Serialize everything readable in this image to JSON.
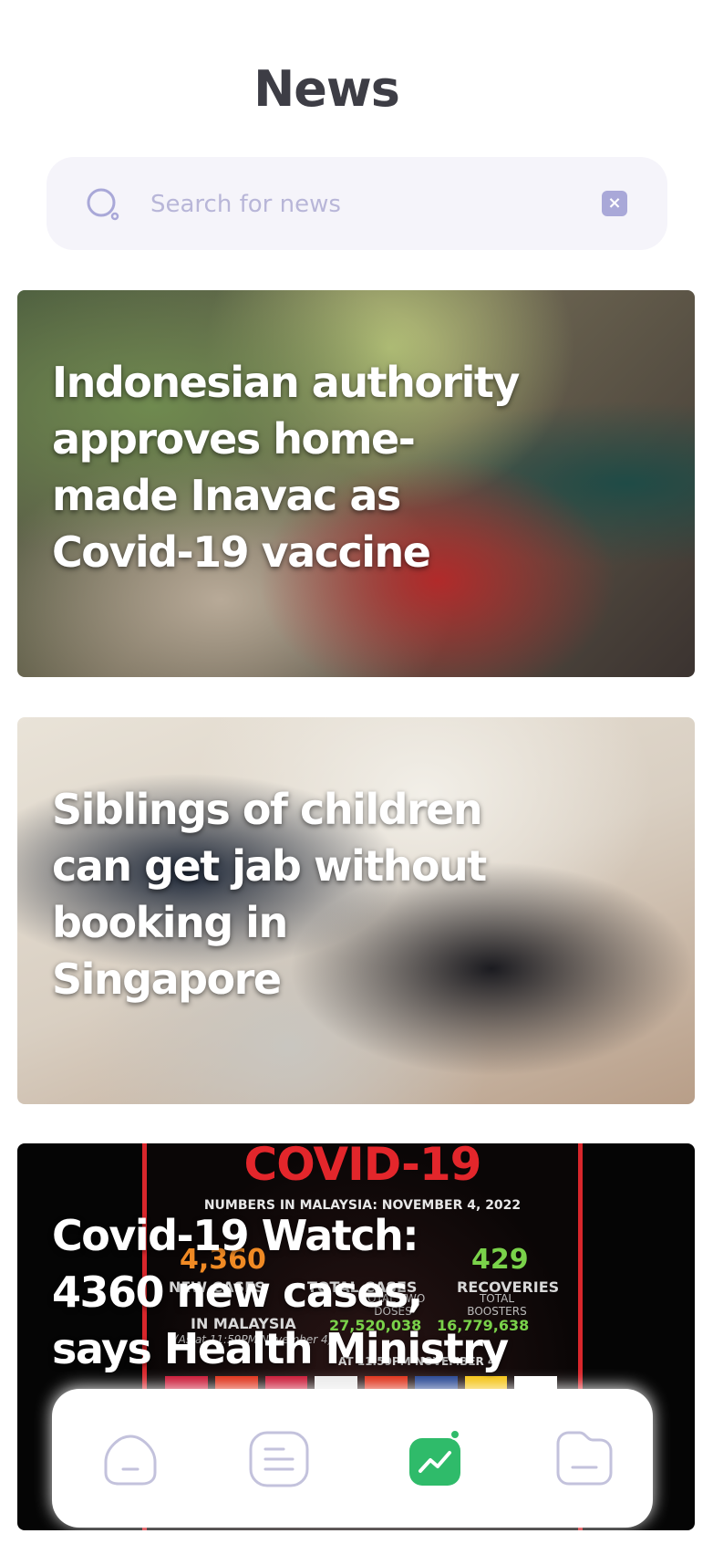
{
  "header": {
    "title": "News"
  },
  "search": {
    "placeholder": "Search for news",
    "value": "",
    "clear_glyph": "×"
  },
  "articles": [
    {
      "headline": "Indonesian authority approves home-made Inavac as Covid-19 vaccine"
    },
    {
      "headline": "Siblings of children can get jab without booking in Singapore"
    },
    {
      "headline": "Covid-19 Watch: 4360 new cases, says Health Ministry"
    }
  ],
  "article3_image": {
    "title": "COVID-19",
    "subtitle": "NUMBERS IN MALAYSIA: NOVEMBER 4, 2022",
    "new_cases_label": "NEW CASES",
    "total_cases_label": "TOTAL CASES",
    "recoveries_label": "RECOVERIES",
    "new_cases": "4,360",
    "recoveries": "429",
    "vaccinated_label": "IN MALAYSIA",
    "vaccinated_note": "(As at 11:59PM November 4)",
    "two_doses_label": "TOTAL TWO DOSES",
    "two_doses": "27,520,038",
    "boosters_label": "TOTAL BOOSTERS",
    "boosters": "16,779,638",
    "footer": "AT 11:59PM NOVEMBER 4)"
  },
  "nav": {
    "items": [
      {
        "icon": "home-icon"
      },
      {
        "icon": "list-icon"
      },
      {
        "icon": "trending-icon",
        "active": true
      },
      {
        "icon": "folder-icon"
      }
    ],
    "active_color": "#2fbb6a",
    "inactive_color": "#c3c2dc"
  }
}
